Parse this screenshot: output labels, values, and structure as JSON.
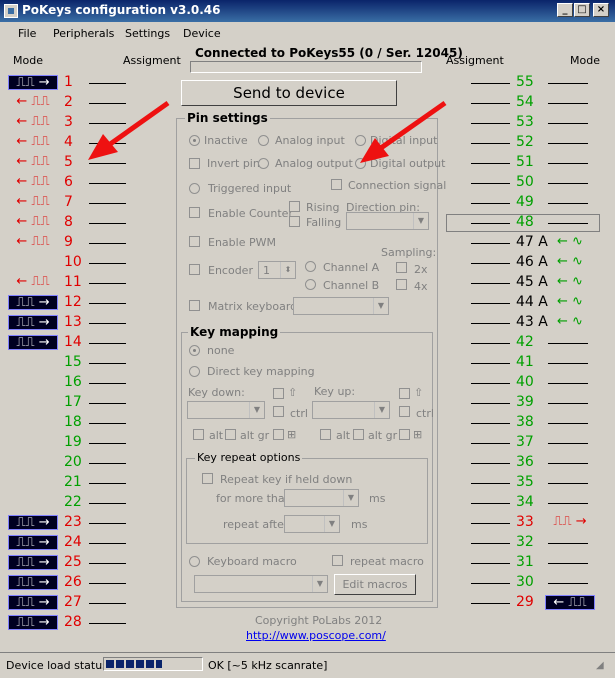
{
  "window": {
    "title": "PoKeys configuration v3.0.46"
  },
  "menu": [
    "File",
    "Peripherals",
    "Settings",
    "Device"
  ],
  "header": {
    "mode_left": "Mode",
    "assign_left": "Assigment",
    "assign_right": "Assigment",
    "mode_right": "Mode",
    "connection": "Connected to PoKeys55 (0 / Ser. 12045)"
  },
  "send_button": "Send to device",
  "left_pins": [
    {
      "num": "1",
      "mode": "⎍⎍ →",
      "style": "boxed",
      "color": "red"
    },
    {
      "num": "2",
      "mode": "← ⎍⎍",
      "style": "red",
      "color": "red"
    },
    {
      "num": "3",
      "mode": "← ⎍⎍",
      "style": "red",
      "color": "red"
    },
    {
      "num": "4",
      "mode": "← ⎍⎍",
      "style": "red",
      "color": "red"
    },
    {
      "num": "5",
      "mode": "← ⎍⎍",
      "style": "red",
      "color": "red"
    },
    {
      "num": "6",
      "mode": "← ⎍⎍",
      "style": "red",
      "color": "red"
    },
    {
      "num": "7",
      "mode": "← ⎍⎍",
      "style": "red",
      "color": "red"
    },
    {
      "num": "8",
      "mode": "← ⎍⎍",
      "style": "red",
      "color": "red"
    },
    {
      "num": "9",
      "mode": "← ⎍⎍",
      "style": "red",
      "color": "red"
    },
    {
      "num": "10",
      "mode": "",
      "style": "none",
      "color": "red"
    },
    {
      "num": "11",
      "mode": "← ⎍⎍",
      "style": "red",
      "color": "red"
    },
    {
      "num": "12",
      "mode": "⎍⎍ →",
      "style": "boxed",
      "color": "red"
    },
    {
      "num": "13",
      "mode": "⎍⎍ →",
      "style": "boxed",
      "color": "red"
    },
    {
      "num": "14",
      "mode": "⎍⎍ →",
      "style": "boxed",
      "color": "red"
    },
    {
      "num": "15",
      "mode": "",
      "style": "none",
      "color": "green"
    },
    {
      "num": "16",
      "mode": "",
      "style": "none",
      "color": "green"
    },
    {
      "num": "17",
      "mode": "",
      "style": "none",
      "color": "green"
    },
    {
      "num": "18",
      "mode": "",
      "style": "none",
      "color": "green"
    },
    {
      "num": "19",
      "mode": "",
      "style": "none",
      "color": "green"
    },
    {
      "num": "20",
      "mode": "",
      "style": "none",
      "color": "green"
    },
    {
      "num": "21",
      "mode": "",
      "style": "none",
      "color": "green"
    },
    {
      "num": "22",
      "mode": "",
      "style": "none",
      "color": "green"
    },
    {
      "num": "23",
      "mode": "⎍⎍ →",
      "style": "boxed",
      "color": "red"
    },
    {
      "num": "24",
      "mode": "⎍⎍ →",
      "style": "boxed",
      "color": "red"
    },
    {
      "num": "25",
      "mode": "⎍⎍ →",
      "style": "boxed",
      "color": "red"
    },
    {
      "num": "26",
      "mode": "⎍⎍ →",
      "style": "boxed",
      "color": "red"
    },
    {
      "num": "27",
      "mode": "⎍⎍ →",
      "style": "boxed",
      "color": "red"
    },
    {
      "num": "28",
      "mode": "⎍⎍ →",
      "style": "boxed",
      "color": "red"
    }
  ],
  "right_pins": [
    {
      "num": "55",
      "mode": "",
      "style": "none",
      "color": "green",
      "selected": false
    },
    {
      "num": "54",
      "mode": "",
      "style": "none",
      "color": "green",
      "selected": false
    },
    {
      "num": "53",
      "mode": "",
      "style": "none",
      "color": "green",
      "selected": false
    },
    {
      "num": "52",
      "mode": "",
      "style": "none",
      "color": "green",
      "selected": false
    },
    {
      "num": "51",
      "mode": "",
      "style": "none",
      "color": "green",
      "selected": false
    },
    {
      "num": "50",
      "mode": "",
      "style": "none",
      "color": "green",
      "selected": false
    },
    {
      "num": "49",
      "mode": "",
      "style": "none",
      "color": "green",
      "selected": false
    },
    {
      "num": "48",
      "mode": "",
      "style": "none",
      "color": "green",
      "selected": true
    },
    {
      "num": "47 A",
      "mode": "← ∿",
      "style": "green",
      "color": "black",
      "selected": false
    },
    {
      "num": "46 A",
      "mode": "← ∿",
      "style": "green",
      "color": "black",
      "selected": false
    },
    {
      "num": "45 A",
      "mode": "← ∿",
      "style": "green",
      "color": "black",
      "selected": false
    },
    {
      "num": "44 A",
      "mode": "← ∿",
      "style": "green",
      "color": "black",
      "selected": false
    },
    {
      "num": "43 A",
      "mode": "← ∿",
      "style": "green",
      "color": "black",
      "selected": false
    },
    {
      "num": "42",
      "mode": "",
      "style": "none",
      "color": "green",
      "selected": false
    },
    {
      "num": "41",
      "mode": "",
      "style": "none",
      "color": "green",
      "selected": false
    },
    {
      "num": "40",
      "mode": "",
      "style": "none",
      "color": "green",
      "selected": false
    },
    {
      "num": "39",
      "mode": "",
      "style": "none",
      "color": "green",
      "selected": false
    },
    {
      "num": "38",
      "mode": "",
      "style": "none",
      "color": "green",
      "selected": false
    },
    {
      "num": "37",
      "mode": "",
      "style": "none",
      "color": "green",
      "selected": false
    },
    {
      "num": "36",
      "mode": "",
      "style": "none",
      "color": "green",
      "selected": false
    },
    {
      "num": "35",
      "mode": "",
      "style": "none",
      "color": "green",
      "selected": false
    },
    {
      "num": "34",
      "mode": "",
      "style": "none",
      "color": "green",
      "selected": false
    },
    {
      "num": "33",
      "mode": "⎍⎍ →",
      "style": "red",
      "color": "red",
      "selected": false
    },
    {
      "num": "32",
      "mode": "",
      "style": "none",
      "color": "green",
      "selected": false
    },
    {
      "num": "31",
      "mode": "",
      "style": "none",
      "color": "green",
      "selected": false
    },
    {
      "num": "30",
      "mode": "",
      "style": "none",
      "color": "green",
      "selected": false
    },
    {
      "num": "29",
      "mode": "← ⎍⎍",
      "style": "boxed",
      "color": "red",
      "selected": false
    }
  ],
  "pin_settings": {
    "title": "Pin settings",
    "inactive": "Inactive",
    "analog_input": "Analog input",
    "digital_input": "Digital input",
    "invert_pin": "Invert pin",
    "analog_output": "Analog output",
    "digital_output": "Digital output",
    "triggered_input": "Triggered input",
    "connection_signal": "Connection signal",
    "enable_counter": "Enable Counter",
    "rising": "Rising",
    "falling": "Falling",
    "direction_pin": "Direction pin:",
    "enable_pwm": "Enable PWM",
    "sampling": "Sampling:",
    "encoder": "Encoder",
    "encoder_value": "1",
    "channel_a": "Channel A",
    "channel_b": "Channel B",
    "x2": "2x",
    "x4": "4x",
    "matrix_keyboard": "Matrix keyboard"
  },
  "key_mapping": {
    "title": "Key mapping",
    "none": "none",
    "direct": "Direct key mapping",
    "key_down": "Key down:",
    "key_up": "Key up:",
    "ctrl": "ctrl",
    "alt": "alt",
    "altgr": "alt gr",
    "repeat_options": "Key repeat options",
    "repeat_if_held": "Repeat key if held down",
    "for_more_than": "for more than",
    "repeat_after": "repeat after",
    "ms": "ms",
    "keyboard_macro": "Keyboard macro",
    "repeat_macro": "repeat macro",
    "edit_macros": "Edit macros"
  },
  "footer": {
    "copyright": "Copyright PoLabs 2012",
    "url": "http://www.poscope.com/"
  },
  "status": {
    "label": "Device load status:",
    "text": "OK [~5 kHz scanrate]",
    "load_fraction": 0.6
  },
  "colors": {
    "pin_red": "#e00000",
    "pin_green": "#00a000",
    "annotation_arrow": "#ee1111",
    "title_bar": "#0a246a"
  }
}
